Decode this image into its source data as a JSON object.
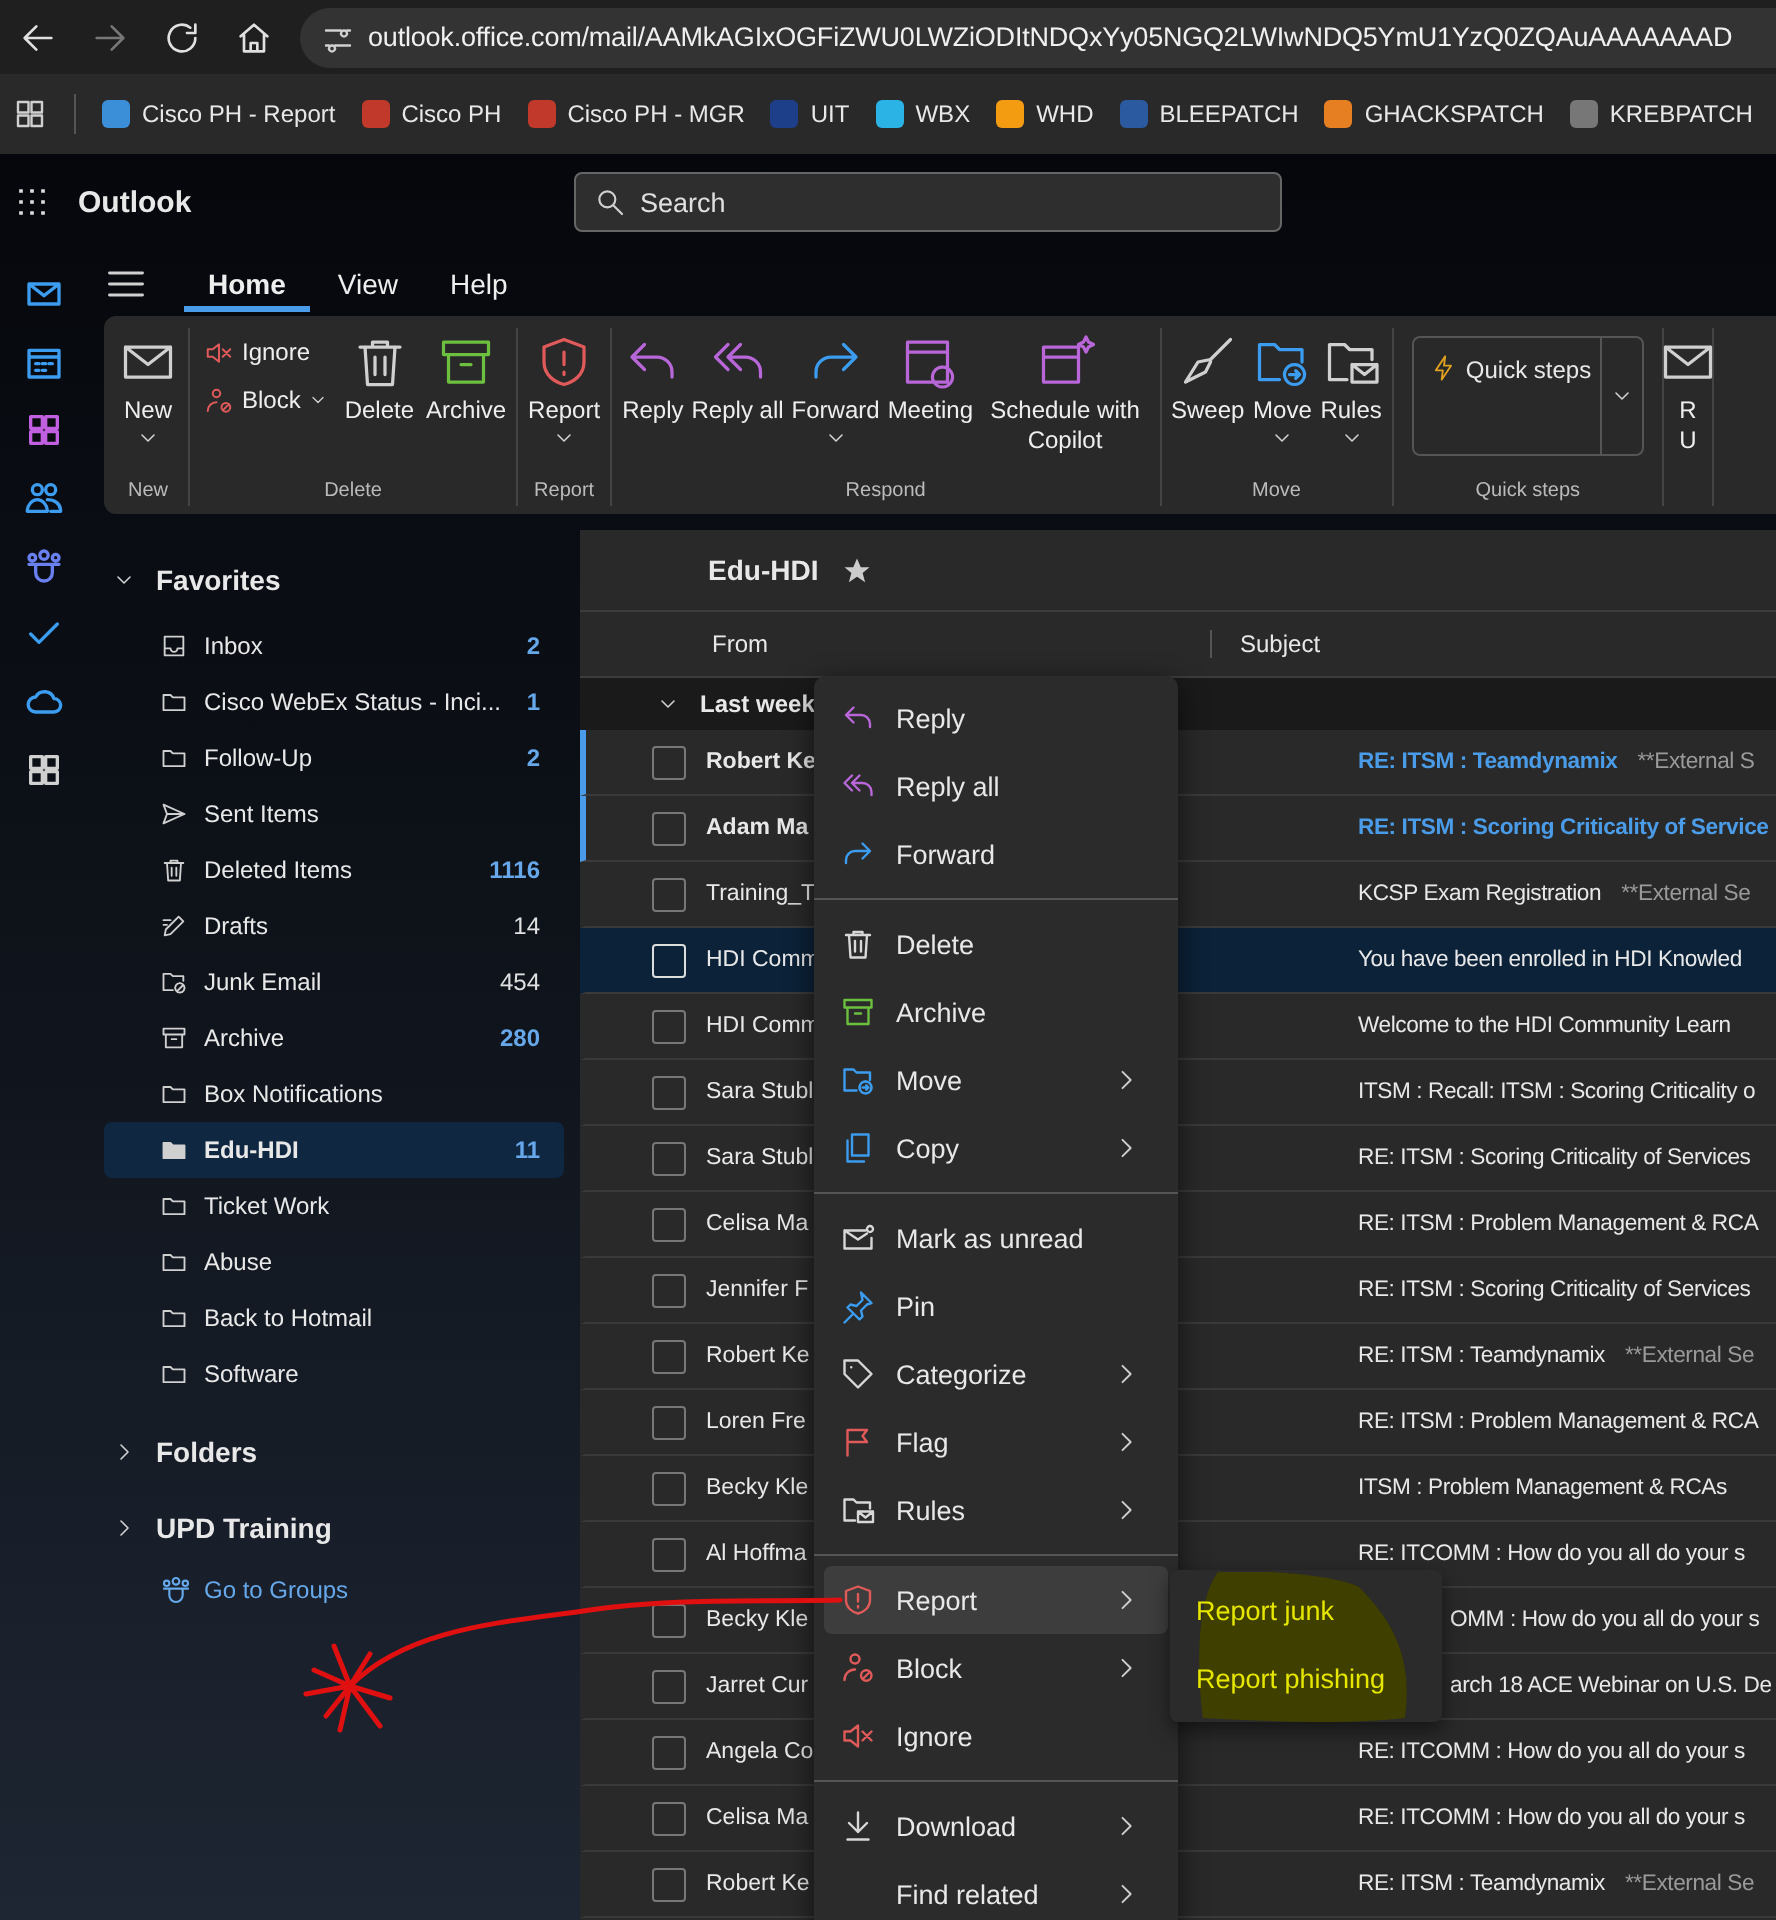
{
  "browser": {
    "url": "outlook.office.com/mail/AAMkAGIxOGFiZWU0LWZiODItNDQxYy05NGQ2LWIwNDQ5YmU1YzQ0ZQAuAAAAAAAD",
    "bookmarks": [
      {
        "label": "Cisco PH - Report",
        "color": "#3a8fd8"
      },
      {
        "label": "Cisco PH",
        "color": "#c0392b"
      },
      {
        "label": "Cisco PH - MGR",
        "color": "#c0392b"
      },
      {
        "label": "UIT",
        "color": "#1d3f8a"
      },
      {
        "label": "WBX",
        "color": "#2bb3e6"
      },
      {
        "label": "WHD",
        "color": "#f39c12"
      },
      {
        "label": "BLEEPATCH",
        "color": "#2c5aa0"
      },
      {
        "label": "GHACKSPATCH",
        "color": "#e67e22"
      },
      {
        "label": "KREBPATCH",
        "color": "#777777"
      }
    ]
  },
  "app": {
    "title": "Outlook",
    "search": {
      "placeholder": "Search"
    }
  },
  "tabs": [
    {
      "label": "Home",
      "selected": true
    },
    {
      "label": "View",
      "selected": false
    },
    {
      "label": "Help",
      "selected": false
    }
  ],
  "ribbon": [
    {
      "label": "New",
      "buttons": [
        {
          "label": "New",
          "dropdown": true
        }
      ]
    },
    {
      "label": "Delete",
      "buttons": [
        {
          "label": "Ignore",
          "dropdown": false
        },
        {
          "label": "Block",
          "dropdown": true
        },
        {
          "label": "Delete",
          "dropdown": false
        },
        {
          "label": "Archive",
          "dropdown": false
        }
      ]
    },
    {
      "label": "Report",
      "buttons": [
        {
          "label": "Report",
          "dropdown": true
        }
      ]
    },
    {
      "label": "Respond",
      "buttons": [
        {
          "label": "Reply",
          "dropdown": false
        },
        {
          "label": "Reply all",
          "dropdown": false
        },
        {
          "label": "Forward",
          "dropdown": true
        },
        {
          "label": "Meeting",
          "dropdown": false
        },
        {
          "label": "Schedule with Copilot",
          "dropdown": false
        }
      ]
    },
    {
      "label": "Move",
      "buttons": [
        {
          "label": "Sweep",
          "dropdown": false
        },
        {
          "label": "Move",
          "dropdown": true
        },
        {
          "label": "Rules",
          "dropdown": true
        }
      ]
    },
    {
      "label": "Quick steps",
      "buttons": [
        {
          "label": "Quick steps",
          "dropdown": true
        }
      ]
    },
    {
      "buttons": [
        {
          "label": "R U",
          "dropdown": false
        }
      ]
    }
  ],
  "folders": {
    "favorites": {
      "label": "Favorites",
      "expanded": true,
      "items": [
        {
          "name": "Inbox",
          "count": "2",
          "count_unread": true,
          "selected": false
        },
        {
          "name": "Cisco WebEx Status - Inci...",
          "count": "1",
          "count_unread": true,
          "selected": false
        },
        {
          "name": "Follow-Up",
          "count": "2",
          "count_unread": true,
          "selected": false
        },
        {
          "name": "Sent Items",
          "selected": false
        },
        {
          "name": "Deleted Items",
          "count": "1116",
          "count_unread": true,
          "selected": false
        },
        {
          "name": "Drafts",
          "count": "14",
          "count_unread": false,
          "selected": false
        },
        {
          "name": "Junk Email",
          "count": "454",
          "count_unread": false,
          "selected": false
        },
        {
          "name": "Archive",
          "count": "280",
          "count_unread": true,
          "selected": false
        },
        {
          "name": "Box Notifications",
          "selected": false
        },
        {
          "name": "Edu-HDI",
          "count": "11",
          "count_unread": true,
          "selected": true
        },
        {
          "name": "Ticket Work",
          "selected": false
        },
        {
          "name": "Abuse",
          "selected": false
        },
        {
          "name": "Back to Hotmail",
          "selected": false
        },
        {
          "name": "Software",
          "selected": false
        }
      ]
    },
    "sections": [
      {
        "label": "Folders",
        "expanded": false
      },
      {
        "label": "UPD Training",
        "expanded": false
      }
    ],
    "groups_link": "Go to Groups"
  },
  "mail_list": {
    "folder": "Edu-HDI",
    "columns": [
      "From",
      "Subject"
    ],
    "group": {
      "label": "Last week",
      "expanded": true
    },
    "rows": [
      {
        "from": "Robert Ke",
        "subject": "RE: ITSM : Teamdynamix",
        "preview": "**External S",
        "unread": true,
        "selected": false,
        "covered": false
      },
      {
        "from": "Adam Ma",
        "subject": "RE: ITSM : Scoring Criticality of Service",
        "unread": true,
        "selected": false,
        "covered": false
      },
      {
        "from": "Training_T",
        "subject": "KCSP Exam Registration",
        "preview": "**External Se",
        "unread": false,
        "selected": false,
        "covered": false
      },
      {
        "from": "HDI Comm",
        "subject": "You have been enrolled in HDI Knowled",
        "unread": false,
        "selected": true,
        "covered": false
      },
      {
        "from": "HDI Comm",
        "subject": "Welcome to the HDI Community Learn",
        "unread": false,
        "selected": false,
        "covered": false
      },
      {
        "from": "Sara Stubl",
        "subject": "ITSM : Recall: ITSM : Scoring Criticality o",
        "unread": false,
        "selected": false,
        "covered": false
      },
      {
        "from": "Sara Stubl",
        "subject": "RE: ITSM : Scoring Criticality of Services",
        "unread": false,
        "selected": false,
        "covered": false
      },
      {
        "from": "Celisa Ma",
        "subject": "RE: ITSM : Problem Management & RCA",
        "unread": false,
        "selected": false,
        "covered": false
      },
      {
        "from": "Jennifer F",
        "subject": "RE: ITSM : Scoring Criticality of Services",
        "unread": false,
        "selected": false,
        "covered": false
      },
      {
        "from": "Robert Ke",
        "subject": "RE: ITSM : Teamdynamix",
        "preview": "**External Se",
        "unread": false,
        "selected": false,
        "covered": false
      },
      {
        "from": "Loren Fre",
        "subject": "RE: ITSM : Problem Management & RCA",
        "unread": false,
        "selected": false,
        "covered": false
      },
      {
        "from": "Becky Kle",
        "subject": "ITSM : Problem Management & RCAs",
        "unread": false,
        "selected": false,
        "covered": false
      },
      {
        "from": "Al Hoffma",
        "subject": "RE: ITCOMM : How do you all do your s",
        "unread": false,
        "selected": false,
        "covered": false
      },
      {
        "from": "Becky Kle",
        "subject": "OMM : How do you all do your s",
        "unread": false,
        "selected": false,
        "covered": true
      },
      {
        "from": "Jarret Cur",
        "subject": "arch 18 ACE Webinar on U.S. De",
        "unread": false,
        "selected": false,
        "covered": true
      },
      {
        "from": "Angela Co",
        "subject": "RE: ITCOMM : How do you all do your s",
        "unread": false,
        "selected": false,
        "covered": false
      },
      {
        "from": "Celisa Ma",
        "subject": "RE: ITCOMM : How do you all do your s",
        "unread": false,
        "selected": false,
        "covered": false
      },
      {
        "from": "Robert Ke",
        "subject": "RE: ITSM : Teamdynamix",
        "preview": "**External Se",
        "unread": false,
        "selected": false,
        "covered": false
      }
    ]
  },
  "context_menu": {
    "sections": [
      [
        {
          "label": "Reply",
          "submenu": false,
          "selected": false
        },
        {
          "label": "Reply all",
          "submenu": false,
          "selected": false
        },
        {
          "label": "Forward",
          "submenu": false,
          "selected": false
        }
      ],
      [
        {
          "label": "Delete",
          "submenu": false,
          "selected": false
        },
        {
          "label": "Archive",
          "submenu": false,
          "selected": false
        },
        {
          "label": "Move",
          "submenu": true,
          "selected": false
        },
        {
          "label": "Copy",
          "submenu": true,
          "selected": false
        }
      ],
      [
        {
          "label": "Mark as unread",
          "submenu": false,
          "selected": false
        },
        {
          "label": "Pin",
          "submenu": false,
          "selected": false
        },
        {
          "label": "Categorize",
          "submenu": true,
          "selected": false
        },
        {
          "label": "Flag",
          "submenu": true,
          "selected": false
        },
        {
          "label": "Rules",
          "submenu": true,
          "selected": false
        }
      ],
      [
        {
          "label": "Report",
          "submenu": true,
          "selected": true
        },
        {
          "label": "Block",
          "submenu": true,
          "selected": false
        },
        {
          "label": "Ignore",
          "submenu": false,
          "selected": false
        }
      ],
      [
        {
          "label": "Download",
          "submenu": true,
          "selected": false
        },
        {
          "label": "Find related",
          "submenu": true,
          "selected": false
        }
      ]
    ],
    "submenu": [
      "Report junk",
      "Report phishing"
    ]
  }
}
